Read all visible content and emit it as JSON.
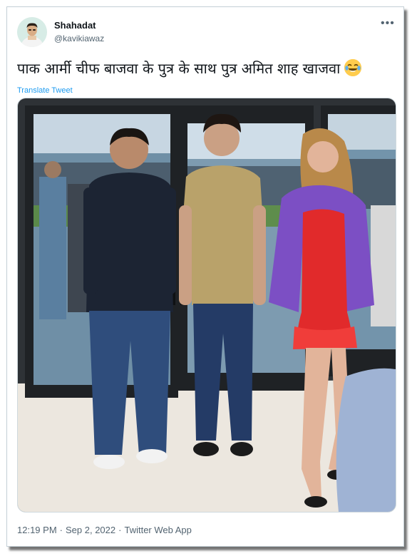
{
  "author": {
    "name": "Shahadat",
    "handle": "@kavikiawaz",
    "avatar_icon": "person-avatar-icon"
  },
  "more_icon": "more-options-icon",
  "tweet": {
    "text": "पाक आर्मी चीफ बाजवा के पुत्र के साथ पुत्र अमित शाह खाजवा",
    "emoji": "face-with-tears-of-joy-icon",
    "translate_label": "Translate Tweet"
  },
  "photo": {
    "subject": "three people posing in front of stadium glass doors"
  },
  "footer": {
    "time": "12:19 PM",
    "date": "Sep 2, 2022",
    "source": "Twitter Web App",
    "separator": "·"
  },
  "colors": {
    "link": "#1d9bf0",
    "text": "#0f1419",
    "secondary": "#536471"
  }
}
